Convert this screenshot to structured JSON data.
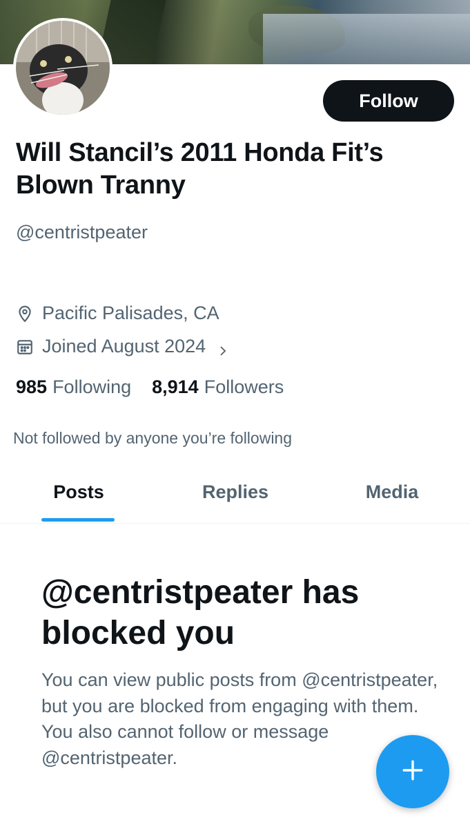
{
  "profile": {
    "display_name": "Will Stancil’s 2011 Honda Fit’s Blown Tranny",
    "handle": "@centristpeater",
    "location": "Pacific Palisades, CA",
    "joined": "Joined August 2024",
    "following_count": "985",
    "following_label": "Following",
    "followers_count": "8,914",
    "followers_label": "Followers",
    "not_followed_text": "Not followed by anyone you’re following",
    "follow_button_label": "Follow"
  },
  "tabs": [
    {
      "label": "Posts",
      "active": true
    },
    {
      "label": "Replies",
      "active": false
    },
    {
      "label": "Media",
      "active": false
    }
  ],
  "blocked": {
    "title": "@centristpeater has blocked you",
    "body": "You can view public posts from @centristpeater, but you are blocked from engaging with them. You also cannot follow or message @centristpeater."
  },
  "icons": {
    "location": "location-pin-icon",
    "calendar": "calendar-icon",
    "chevron": "chevron-right-icon",
    "compose": "plus-icon"
  },
  "colors": {
    "accent": "#1d9bf0",
    "text_primary": "#0f1419",
    "text_secondary": "#536471",
    "button_bg": "#0f1419"
  }
}
